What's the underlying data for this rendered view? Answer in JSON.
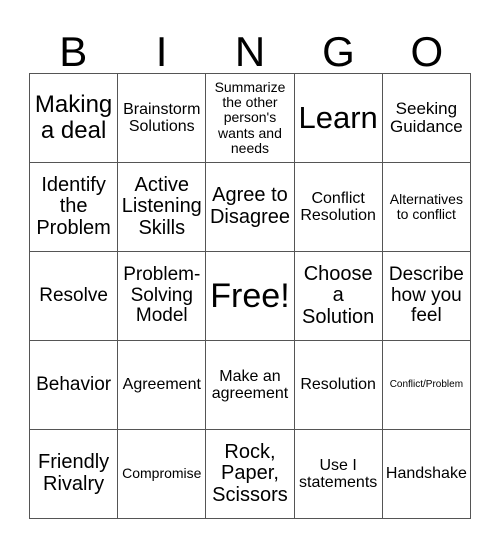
{
  "header": [
    "B",
    "I",
    "N",
    "G",
    "O"
  ],
  "rows": [
    [
      "Making a deal",
      "Brainstorm Solutions",
      "Summarize the other person's wants and needs",
      "Learn",
      "Seeking Guidance"
    ],
    [
      "Identify the Problem",
      "Active Listening Skills",
      "Agree to Disagree",
      "Conflict Resolution",
      "Alternatives to conflict"
    ],
    [
      "Resolve",
      "Problem-Solving Model",
      "Free!",
      "Choose a Solution",
      "Describe how you feel"
    ],
    [
      "Behavior",
      "Agreement",
      "Make an agreement",
      "Resolution",
      "Conflict/Problem"
    ],
    [
      "Friendly Rivalry",
      "Compromise",
      "Rock, Paper, Scissors",
      "Use I statements",
      "Handshake"
    ]
  ]
}
